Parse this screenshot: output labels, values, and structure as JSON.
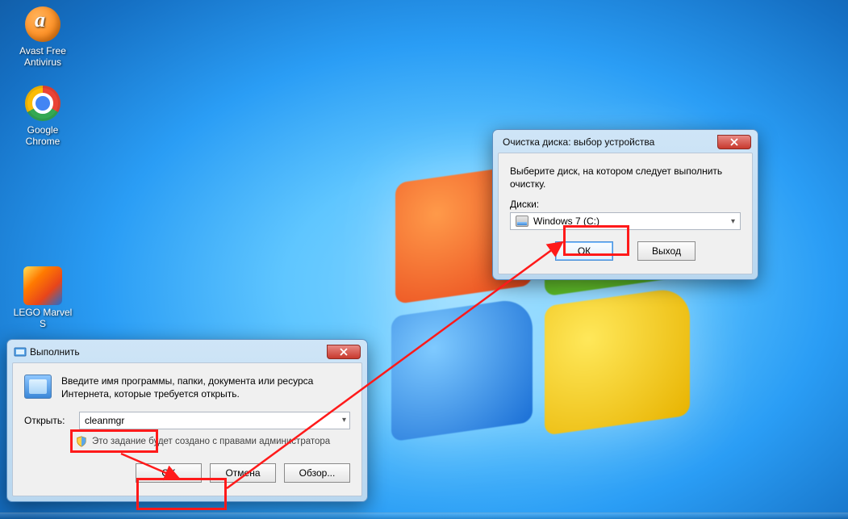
{
  "desktop": {
    "icons": [
      {
        "id": "avast",
        "label": "Avast Free\nAntivirus"
      },
      {
        "id": "chrome",
        "label": "Google\nChrome"
      },
      {
        "id": "lego",
        "label": "LEGO Marvel\nS"
      }
    ]
  },
  "run_dialog": {
    "title": "Выполнить",
    "description": "Введите имя программы, папки, документа или ресурса Интернета, которые требуется открыть.",
    "open_label": "Открыть:",
    "command_value": "cleanmgr",
    "admin_note": "Это задание будет создано с правами администратора",
    "buttons": {
      "ok": "OK",
      "cancel": "Отмена",
      "browse": "Обзор..."
    }
  },
  "cleanup_dialog": {
    "title": "Очистка диска: выбор устройства",
    "instruction": "Выберите диск, на котором следует выполнить очистку.",
    "drive_label": "Диски:",
    "drive_value": "Windows 7 (C:)",
    "buttons": {
      "ok": "ОК",
      "exit": "Выход"
    }
  }
}
